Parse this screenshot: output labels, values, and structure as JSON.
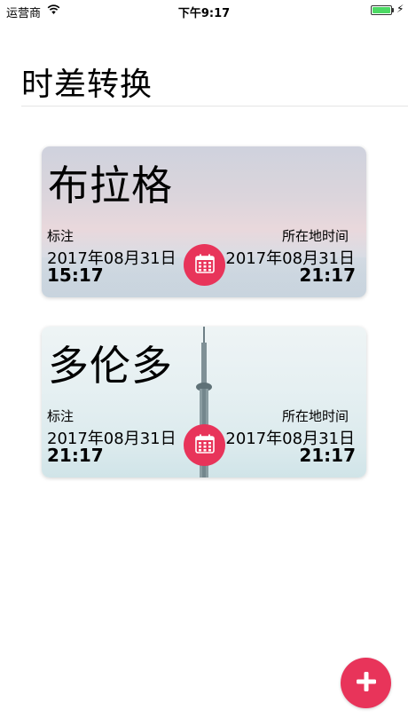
{
  "status_bar": {
    "carrier": "运营商",
    "time": "下午9:17",
    "battery_level": 1.0
  },
  "page": {
    "title": "时差转换"
  },
  "cards": [
    {
      "city": "布拉格",
      "left_label": "标注",
      "left_date": "2017年08月31日",
      "left_time": "15:17",
      "right_label": "所在地时间",
      "right_date": "2017年08月31日",
      "right_time": "21:17",
      "icon": "calendar-icon"
    },
    {
      "city": "多伦多",
      "left_label": "标注",
      "left_date": "2017年08月31日",
      "left_time": "21:17",
      "right_label": "所在地时间",
      "right_date": "2017年08月31日",
      "right_time": "21:17",
      "icon": "calendar-icon"
    }
  ],
  "fab": {
    "icon": "plus-icon"
  },
  "colors": {
    "accent": "#e8345a"
  }
}
